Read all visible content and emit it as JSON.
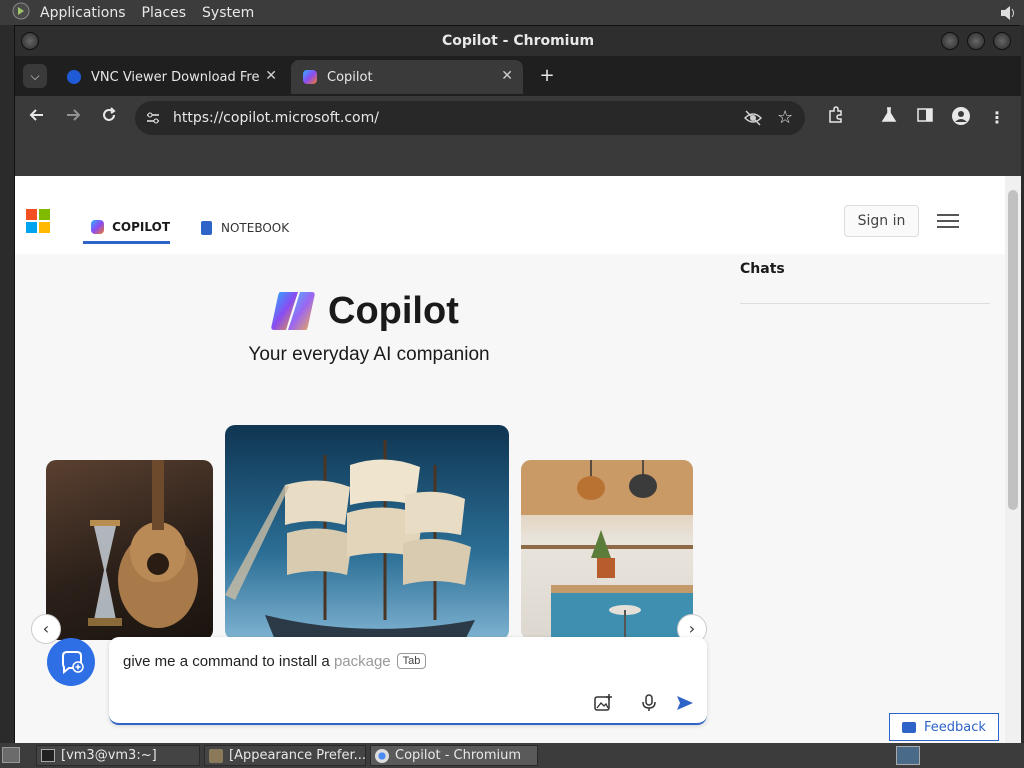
{
  "top_panel": {
    "menus": [
      "Applications",
      "Places",
      "System"
    ]
  },
  "window": {
    "title": "Copilot - Chromium"
  },
  "tabs": [
    {
      "label": "VNC Viewer Download Free",
      "active": false
    },
    {
      "label": "Copilot",
      "active": true
    }
  ],
  "toolbar": {
    "url": "https://copilot.microsoft.com/"
  },
  "page": {
    "nav_tabs": [
      {
        "label": "COPILOT",
        "active": true
      },
      {
        "label": "NOTEBOOK",
        "active": false
      }
    ],
    "sign_in_label": "Sign in",
    "hero_title": "Copilot",
    "hero_subtitle": "Your everyday AI companion",
    "composer": {
      "typed_text": "give me a command to install a ",
      "suggestion": "package",
      "tab_hint": "Tab"
    },
    "chats_title": "Chats",
    "feedback_label": "Feedback"
  },
  "taskbar": {
    "items": [
      {
        "label": "[vm3@vm3:~]"
      },
      {
        "label": "[Appearance Prefer..."
      },
      {
        "label": "Copilot - Chromium"
      }
    ]
  },
  "colors": {
    "accent": "#2e63c8",
    "new_chat_button": "#2f6fe5",
    "ms_logo": [
      "#f25022",
      "#7fba00",
      "#00a4ef",
      "#ffb900"
    ]
  }
}
